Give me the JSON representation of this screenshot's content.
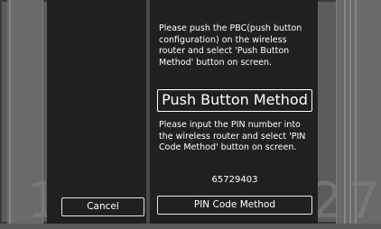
{
  "instructions": {
    "push_button": "Please push the PBC(push button configuration) on the wireless router and select 'Push Button Method' button on screen.",
    "pin_code": "Please input the PIN number into the wireless router and select 'PIN Code Method' button on screen."
  },
  "buttons": {
    "push_button_method": "Push Button Method",
    "pin_code_method": "PIN Code Method",
    "cancel": "Cancel"
  },
  "pin_number": "65729403",
  "background_numbers": {
    "left": "1",
    "right_a": "2",
    "right_b": "7"
  }
}
